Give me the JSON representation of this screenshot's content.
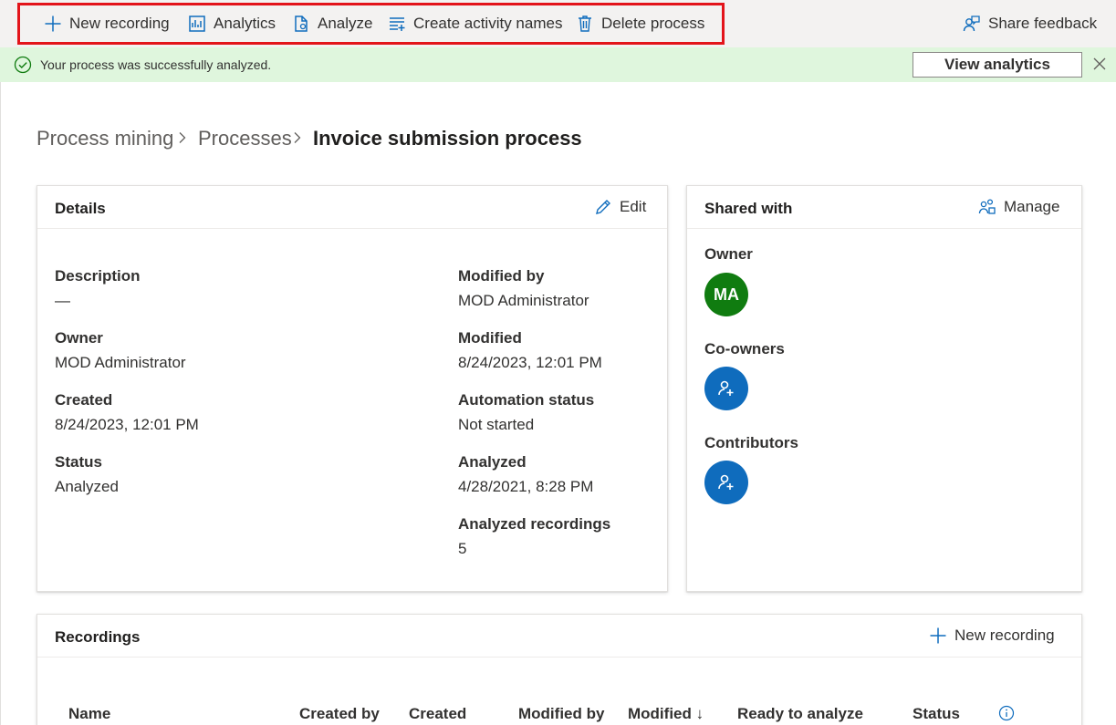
{
  "command_bar": {
    "new_recording": "New recording",
    "analytics": "Analytics",
    "analyze": "Analyze",
    "create_activity_names": "Create activity names",
    "delete_process": "Delete process",
    "share_feedback": "Share feedback"
  },
  "message_bar": {
    "text": "Your process was successfully analyzed.",
    "button": "View analytics"
  },
  "breadcrumb": [
    "Process mining",
    "Processes",
    "Invoice submission process"
  ],
  "details": {
    "title": "Details",
    "edit_label": "Edit",
    "description": {
      "label": "Description",
      "value": "—"
    },
    "owner": {
      "label": "Owner",
      "value": "MOD Administrator"
    },
    "created": {
      "label": "Created",
      "value": "8/24/2023, 12:01 PM"
    },
    "status": {
      "label": "Status",
      "value": "Analyzed"
    },
    "modified_by": {
      "label": "Modified by",
      "value": "MOD Administrator"
    },
    "modified": {
      "label": "Modified",
      "value": "8/24/2023, 12:01 PM"
    },
    "automation_status": {
      "label": "Automation status",
      "value": "Not started"
    },
    "analyzed": {
      "label": "Analyzed",
      "value": "4/28/2021, 8:28 PM"
    },
    "analyzed_recordings": {
      "label": "Analyzed recordings",
      "value": "5"
    }
  },
  "shared_with": {
    "title": "Shared with",
    "manage_label": "Manage",
    "owner_label": "Owner",
    "owner_initials": "MA",
    "owner_color": "#107c10",
    "coowners_label": "Co-owners",
    "contributors_label": "Contributors",
    "add_color": "#0f6cbd"
  },
  "recordings": {
    "title": "Recordings",
    "new_recording_label": "New recording",
    "columns": [
      "Name",
      "Created by",
      "Created",
      "Modified by",
      "Modified ↓",
      "Ready to analyze",
      "Status"
    ]
  },
  "colors": {
    "accent": "#0f6cbd",
    "success_bg": "#dff6dd",
    "success_icon": "#107c10",
    "highlight": "#e3141a"
  }
}
